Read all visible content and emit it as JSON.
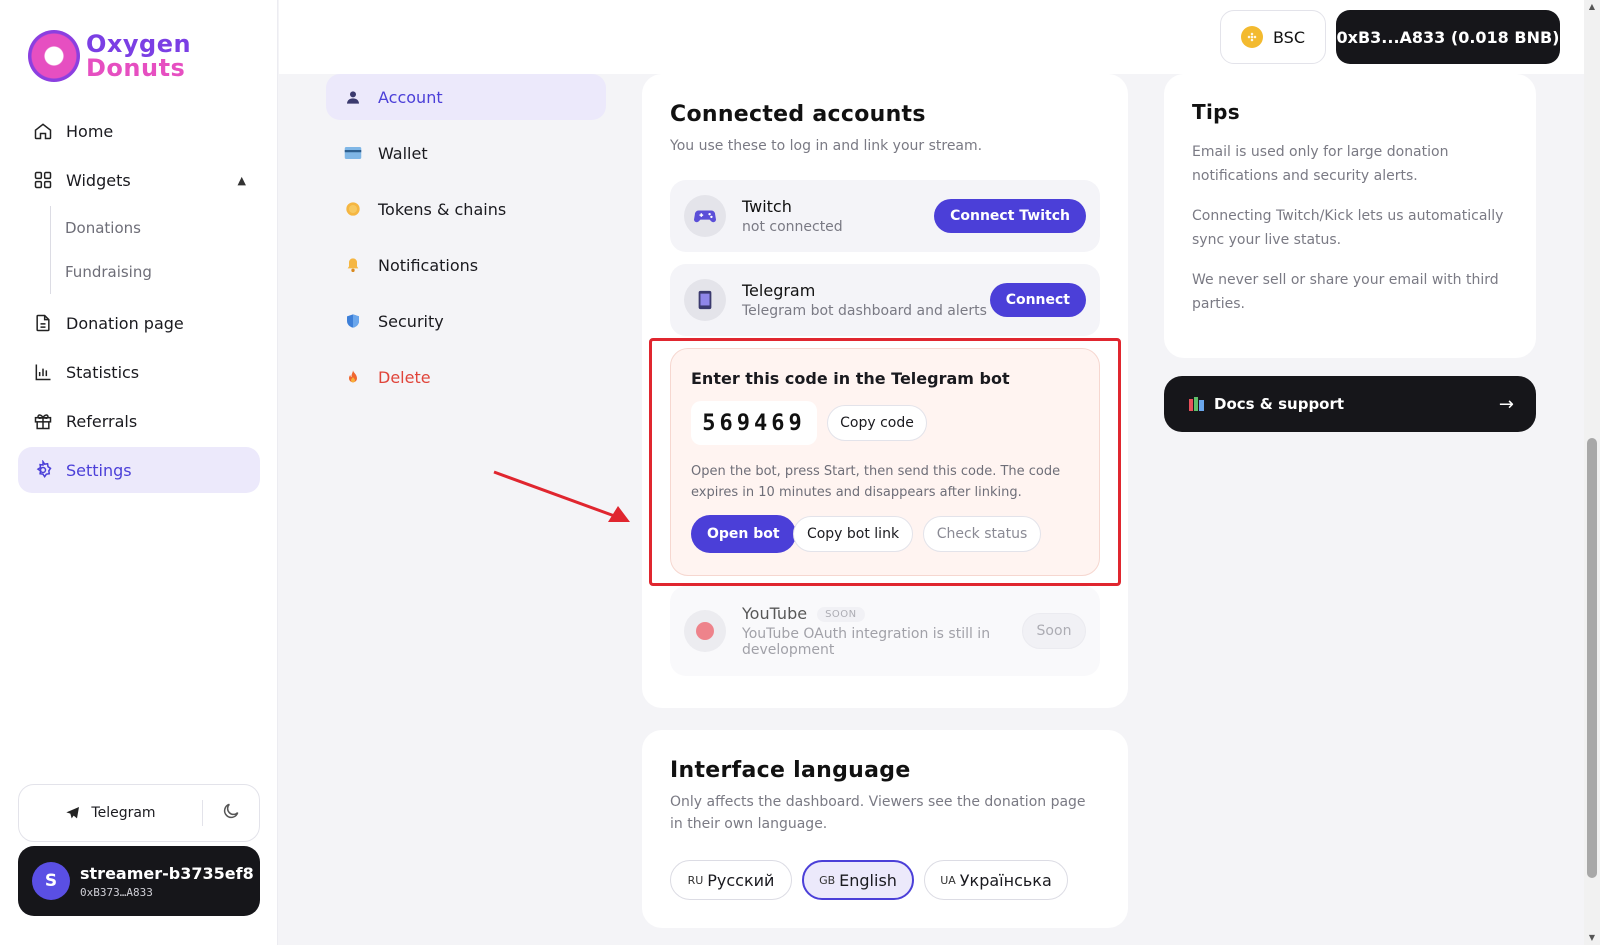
{
  "brand": {
    "line1": "Oxygen",
    "line2": "Donuts"
  },
  "nav": {
    "items": [
      {
        "label": "Home",
        "icon": "home-icon"
      },
      {
        "label": "Widgets",
        "icon": "grid-icon"
      },
      {
        "label": "Donation page",
        "icon": "document-icon"
      },
      {
        "label": "Statistics",
        "icon": "bar-chart-icon"
      },
      {
        "label": "Referrals",
        "icon": "gift-icon"
      },
      {
        "label": "Settings",
        "icon": "gear-icon"
      }
    ],
    "widgets_sub": [
      "Donations",
      "Fundraising"
    ],
    "caret": "▲"
  },
  "footer": {
    "telegram_label": "Telegram"
  },
  "user": {
    "initial": "S",
    "name": "streamer-b3735ef8",
    "address": "0xB373…A833"
  },
  "header": {
    "chain": "BSC",
    "wallet": "0xB3...A833 (0.018 BNB)"
  },
  "settings_menu": [
    {
      "label": "Account",
      "icon": "user-icon"
    },
    {
      "label": "Wallet",
      "icon": "card-icon"
    },
    {
      "label": "Tokens & chains",
      "icon": "coin-icon"
    },
    {
      "label": "Notifications",
      "icon": "bell-icon"
    },
    {
      "label": "Security",
      "icon": "shield-icon"
    },
    {
      "label": "Delete",
      "icon": "fire-icon"
    }
  ],
  "accounts": {
    "title": "Connected accounts",
    "subtitle": "You use these to log in and link your stream.",
    "twitch": {
      "name": "Twitch",
      "status": "not connected",
      "button": "Connect Twitch"
    },
    "telegram": {
      "name": "Telegram",
      "status": "Telegram bot dashboard and alerts",
      "button": "Connect"
    },
    "code": {
      "title": "Enter this code in the Telegram bot",
      "value": "569469",
      "copy_code": "Copy code",
      "help": "Open the bot, press Start, then send this code. The code expires in 10 minutes and disappears after linking.",
      "open_bot": "Open bot",
      "copy_link": "Copy bot link",
      "check_status": "Check status"
    },
    "youtube": {
      "name": "YouTube",
      "badge": "SOON",
      "status": "YouTube OAuth integration is still in development",
      "button": "Soon"
    }
  },
  "language": {
    "title": "Interface language",
    "subtitle": "Only affects the dashboard. Viewers see the donation page in their own language.",
    "options": [
      {
        "code": "RU",
        "label": "Русский"
      },
      {
        "code": "GB",
        "label": "English"
      },
      {
        "code": "UA",
        "label": "Українська"
      }
    ],
    "selected": "English"
  },
  "tips": {
    "title": "Tips",
    "items": [
      "Email is used only for large donation notifications and security alerts.",
      "Connecting Twitch/Kick lets us automatically sync your live status.",
      "We never sell or share your email with third parties."
    ]
  },
  "docs": {
    "label": "Docs & support",
    "arrow": "→"
  },
  "colors": {
    "accent": "#4b3fd8",
    "dark": "#16161a",
    "danger": "#e0443a",
    "highlight": "#e0262f"
  }
}
